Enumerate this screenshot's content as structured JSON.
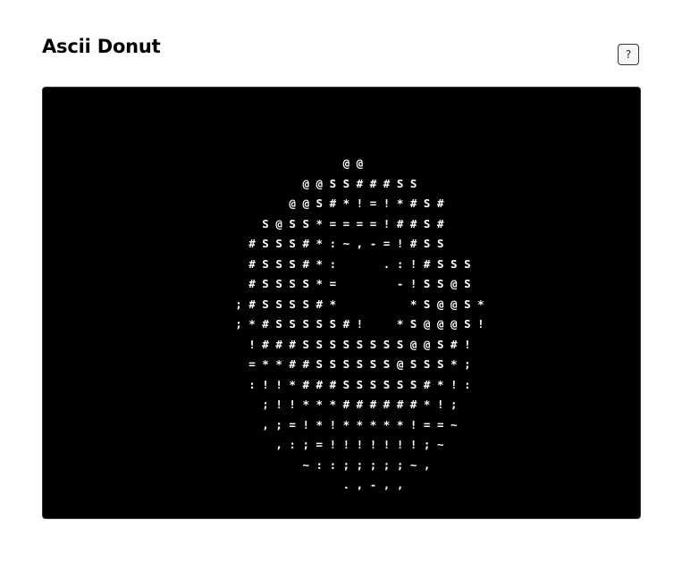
{
  "title": "Ascii Donut",
  "help_button": {
    "label": "?",
    "icon": "question-icon"
  },
  "canvas": {
    "background": "#000000",
    "foreground": "#ffffff",
    "ascii_art": "                        @ @\n                  @ @ S S # # # S S\n                @ @ S # * ! = ! * # S #\n            S @ S S * = = = = ! # # S #\n          # S S S # * : ~ , - = ! # S S\n          # S S S # * :       . : ! # S S S\n          # S S S S * =         - ! S S @ S\n        ; # S S S S # *           * S @ @ S *\n        ; * # S S S S S # !     * S @ @ @ S !\n          ! # # # S S S S S S S S @ @ S # !\n          = * * # # S S S S S S @ S S S * ;\n          : ! ! * # # # S S S S S S # * ! :\n            ; ! ! * * * # # # # # # * ! ;\n            , ; = ! * ! * * * * * ! = = ~\n              , : ; = ! ! ! ! ! ! ! ; ~\n                  ~ : : ; ; ; ; ; ~ ,\n                        . , - , ,"
  }
}
